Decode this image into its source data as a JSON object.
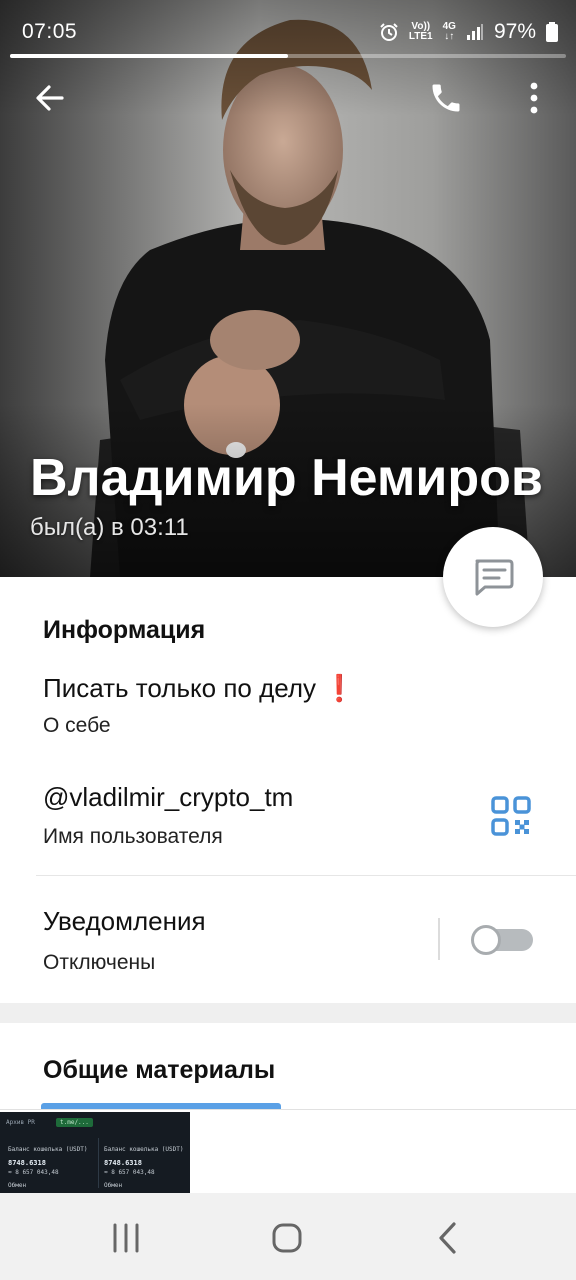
{
  "status_bar": {
    "time": "07:05",
    "network_top": "Vo))",
    "network_bottom": "LTE1",
    "signal_type": "4G",
    "battery": "97%",
    "icons": [
      "alarm-icon",
      "volte-icon",
      "data-arrows-icon",
      "signal-icon",
      "battery-icon"
    ]
  },
  "story_progress": 0.5,
  "toolbar": {
    "back_icon": "arrow-left-icon",
    "call_icon": "phone-icon",
    "menu_icon": "more-vertical-icon"
  },
  "profile": {
    "name": "Владимир Немиров",
    "last_seen": "был(а) в 03:11"
  },
  "fab": {
    "icon": "message-icon"
  },
  "info": {
    "title": "Информация",
    "bio": {
      "value": "Писать только по делу",
      "emoji": "❗",
      "label": "О себе"
    },
    "username": {
      "value": "@vladilmir_crypto_tm",
      "label": "Имя пользователя",
      "icon": "qr-code-icon"
    },
    "notifications": {
      "value": "Уведомления",
      "label": "Отключены",
      "enabled": false
    }
  },
  "shared": {
    "title": "Общие материалы",
    "thumb": {
      "chip_left": "Архив PR",
      "chip_right": "t.me/...",
      "col1_label": "Баланс кошелька (USDT)",
      "col1_value": "8748.6318",
      "col1_sub": "≈ 8 657 043,48",
      "col1_foot": "Обмен",
      "col2_label": "Баланс кошелька (USDT)",
      "col2_value": "8748.6318",
      "col2_sub": "≈ 8 657 043,48",
      "col2_foot": "Обмен"
    }
  },
  "navbar": {
    "recent_icon": "recent-apps-icon",
    "home_icon": "home-icon",
    "back_icon": "back-chevron-icon"
  }
}
